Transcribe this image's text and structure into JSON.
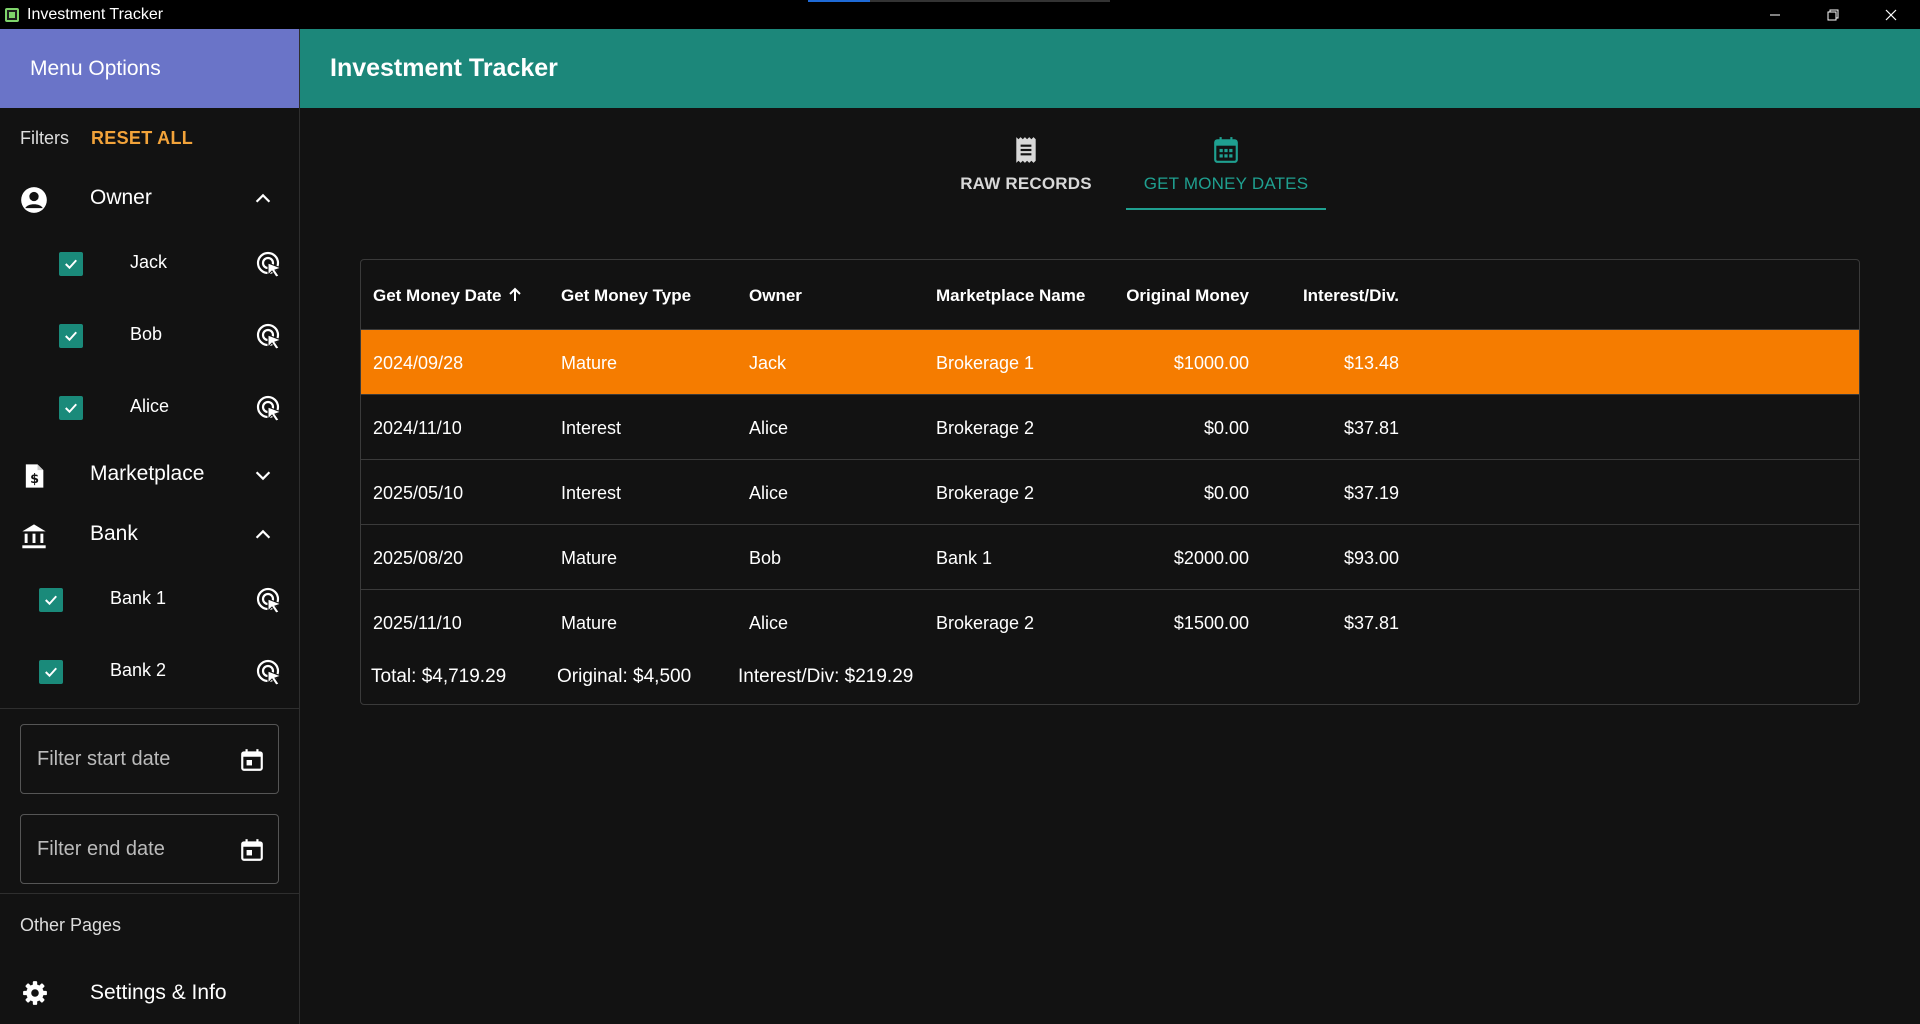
{
  "window": {
    "title": "Investment Tracker"
  },
  "sidebar": {
    "header": "Menu Options",
    "filters_label": "Filters",
    "reset_all": "RESET ALL",
    "owner": {
      "label": "Owner",
      "items": [
        "Jack",
        "Bob",
        "Alice"
      ]
    },
    "marketplace": {
      "label": "Marketplace"
    },
    "bank": {
      "label": "Bank",
      "items": [
        "Bank 1",
        "Bank 2"
      ]
    },
    "start_date_placeholder": "Filter start date",
    "end_date_placeholder": "Filter end date",
    "other_pages": "Other Pages",
    "settings": "Settings & Info"
  },
  "header": {
    "title": "Investment Tracker"
  },
  "tabs": [
    {
      "label": "RAW RECORDS",
      "icon": "receipt-icon"
    },
    {
      "label": "GET MONEY DATES",
      "icon": "calendar-icon"
    }
  ],
  "table": {
    "columns": [
      "Get Money Date",
      "Get Money Type",
      "Owner",
      "Marketplace Name",
      "Original Money",
      "Interest/Div."
    ],
    "rows": [
      [
        "2024/09/28",
        "Mature",
        "Jack",
        "Brokerage 1",
        "$1000.00",
        "$13.48"
      ],
      [
        "2024/11/10",
        "Interest",
        "Alice",
        "Brokerage 2",
        "$0.00",
        "$37.81"
      ],
      [
        "2025/05/10",
        "Interest",
        "Alice",
        "Brokerage 2",
        "$0.00",
        "$37.19"
      ],
      [
        "2025/08/20",
        "Mature",
        "Bob",
        "Bank 1",
        "$2000.00",
        "$93.00"
      ],
      [
        "2025/11/10",
        "Mature",
        "Alice",
        "Brokerage 2",
        "$1500.00",
        "$37.81"
      ]
    ],
    "totals": {
      "total": "Total: $4,719.29",
      "original": "Original: $4,500",
      "interest": "Interest/Div: $219.29"
    }
  },
  "colors": {
    "sidebar_header": "#6a74c8",
    "app_header": "#1c877a",
    "accent": "#1fa090",
    "reset": "#f2a33a",
    "selected_row": "#f57c00"
  }
}
